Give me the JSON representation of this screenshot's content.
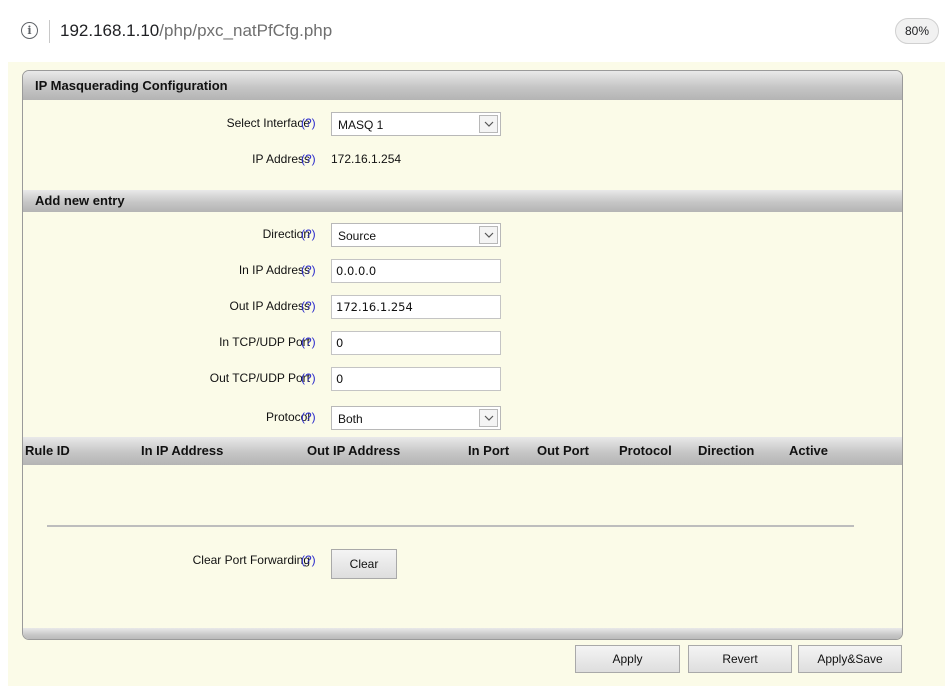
{
  "address_bar": {
    "host": "192.168.1.10",
    "path": "/php/pxc_natPfCfg.php",
    "zoom": "80%",
    "info_icon": "info-icon"
  },
  "panel": {
    "title": "IP Masquerading Configuration",
    "help_text": "(?)",
    "select_interface": {
      "label": "Select Interface",
      "value": "MASQ 1"
    },
    "ip_address": {
      "label": "IP Address",
      "value": "172.16.1.254"
    },
    "add_entry": {
      "title": "Add new entry",
      "direction": {
        "label": "Direction",
        "value": "Source"
      },
      "in_ip": {
        "label": "In IP Address",
        "value": "0.0.0.0"
      },
      "out_ip": {
        "label": "Out IP Address",
        "value": "172.16.1.254"
      },
      "in_port": {
        "label": "In TCP/UDP Port",
        "value": "0"
      },
      "out_port": {
        "label": "Out TCP/UDP Port",
        "value": "0"
      },
      "protocol": {
        "label": "Protocol",
        "value": "Both"
      }
    },
    "table": {
      "columns": [
        "Rule ID",
        "In IP Address",
        "Out IP Address",
        "In Port",
        "Out Port",
        "Protocol",
        "Direction",
        "Active"
      ],
      "rows": []
    },
    "clear": {
      "label": "Clear Port Forwarding",
      "button": "Clear"
    }
  },
  "footer_buttons": {
    "apply": "Apply",
    "revert": "Revert",
    "apply_save": "Apply&Save"
  },
  "colors": {
    "page_bg": "#fbfbe8",
    "help_link": "#2a2acb",
    "header_gradient_mid": "#c6c6c6"
  }
}
